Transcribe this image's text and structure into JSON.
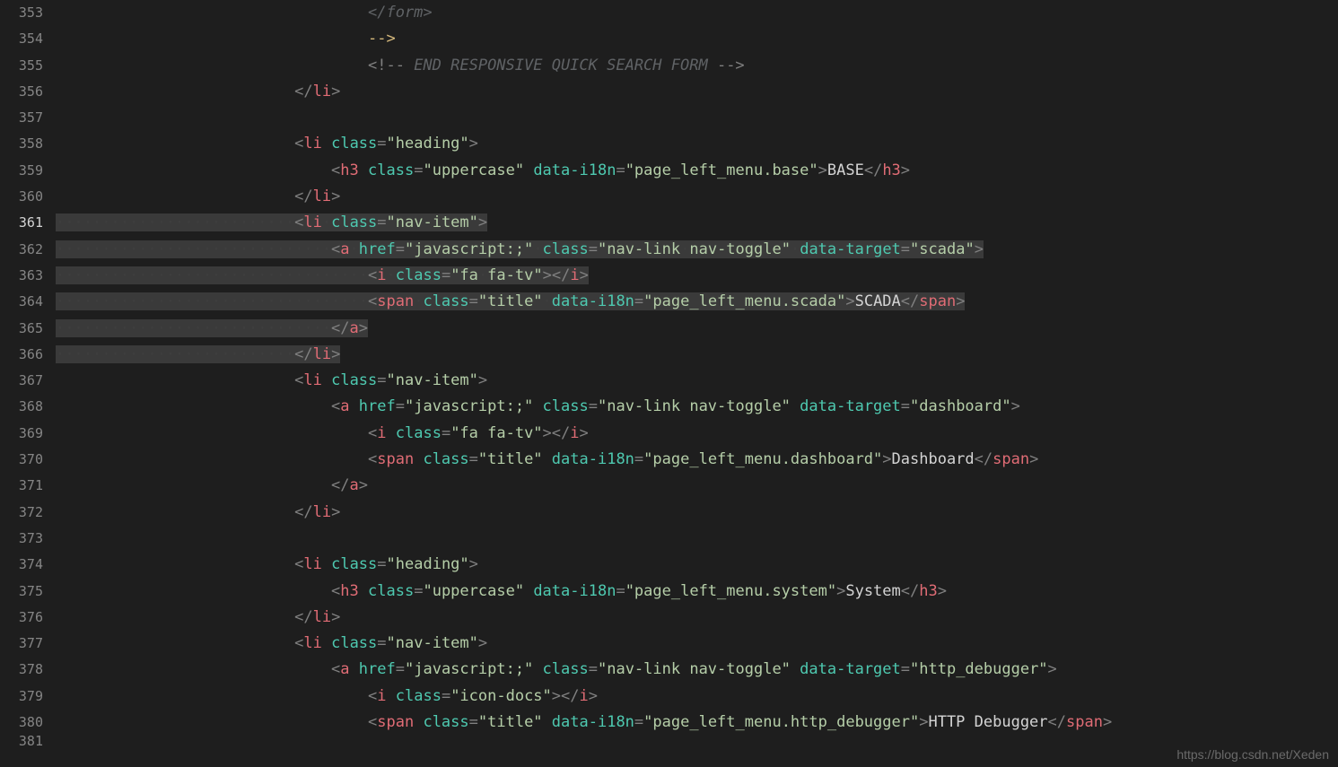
{
  "watermark": "https://blog.csdn.net/Xeden",
  "gutter": {
    "start": 353,
    "end": 381,
    "current": 361
  },
  "whitespace_dot": "·",
  "lines": [
    {
      "n": 353,
      "indent": 40,
      "hl": false,
      "tokens": [
        {
          "c": "cmt",
          "t": "</form>"
        }
      ]
    },
    {
      "n": 354,
      "indent": 40,
      "hl": false,
      "tokens": [
        {
          "c": "yellow",
          "t": "-->"
        }
      ]
    },
    {
      "n": 355,
      "indent": 40,
      "hl": false,
      "tokens": [
        {
          "c": "cmtmark",
          "t": "<!--"
        },
        {
          "c": "cmt",
          "t": " END RESPONSIVE QUICK SEARCH FORM "
        },
        {
          "c": "cmtmark",
          "t": "-->"
        }
      ]
    },
    {
      "n": 356,
      "indent": 32,
      "hl": false,
      "tokens": [
        {
          "c": "br",
          "t": "</"
        },
        {
          "c": "tag",
          "t": "li"
        },
        {
          "c": "br",
          "t": ">"
        }
      ]
    },
    {
      "n": 357,
      "indent": 0,
      "hl": false,
      "tokens": []
    },
    {
      "n": 358,
      "indent": 32,
      "hl": false,
      "tokens": [
        {
          "c": "br",
          "t": "<"
        },
        {
          "c": "tag",
          "t": "li"
        },
        {
          "c": "txt",
          "t": " "
        },
        {
          "c": "attr",
          "t": "class"
        },
        {
          "c": "br",
          "t": "="
        },
        {
          "c": "str",
          "t": "\"heading\""
        },
        {
          "c": "br",
          "t": ">"
        }
      ]
    },
    {
      "n": 359,
      "indent": 36,
      "hl": false,
      "tokens": [
        {
          "c": "br",
          "t": "<"
        },
        {
          "c": "tag",
          "t": "h3"
        },
        {
          "c": "txt",
          "t": " "
        },
        {
          "c": "attr",
          "t": "class"
        },
        {
          "c": "br",
          "t": "="
        },
        {
          "c": "str",
          "t": "\"uppercase\""
        },
        {
          "c": "txt",
          "t": " "
        },
        {
          "c": "attr",
          "t": "data-i18n"
        },
        {
          "c": "br",
          "t": "="
        },
        {
          "c": "str",
          "t": "\"page_left_menu.base\""
        },
        {
          "c": "br",
          "t": ">"
        },
        {
          "c": "txt",
          "t": "BASE"
        },
        {
          "c": "br",
          "t": "</"
        },
        {
          "c": "tag",
          "t": "h3"
        },
        {
          "c": "br",
          "t": ">"
        }
      ]
    },
    {
      "n": 360,
      "indent": 32,
      "hl": false,
      "tokens": [
        {
          "c": "br",
          "t": "</"
        },
        {
          "c": "tag",
          "t": "li"
        },
        {
          "c": "br",
          "t": ">"
        }
      ]
    },
    {
      "n": 361,
      "indent": 32,
      "hl": true,
      "tokens": [
        {
          "c": "br",
          "t": "<"
        },
        {
          "c": "tag",
          "t": "li"
        },
        {
          "c": "ws",
          "t": "·"
        },
        {
          "c": "attr",
          "t": "class"
        },
        {
          "c": "br",
          "t": "="
        },
        {
          "c": "str",
          "t": "\"nav-item\""
        },
        {
          "c": "br",
          "t": ">"
        }
      ]
    },
    {
      "n": 362,
      "indent": 36,
      "hl": true,
      "tokens": [
        {
          "c": "br",
          "t": "<"
        },
        {
          "c": "tag",
          "t": "a"
        },
        {
          "c": "ws",
          "t": "·"
        },
        {
          "c": "attr",
          "t": "href"
        },
        {
          "c": "br",
          "t": "="
        },
        {
          "c": "str",
          "t": "\"javascript:;\""
        },
        {
          "c": "ws",
          "t": "·"
        },
        {
          "c": "attr",
          "t": "class"
        },
        {
          "c": "br",
          "t": "="
        },
        {
          "c": "str",
          "t": "\"nav-link"
        },
        {
          "c": "ws",
          "t": "·"
        },
        {
          "c": "str",
          "t": "nav-toggle\""
        },
        {
          "c": "ws",
          "t": "·"
        },
        {
          "c": "attr",
          "t": "data-target"
        },
        {
          "c": "br",
          "t": "="
        },
        {
          "c": "str",
          "t": "\"scada\""
        },
        {
          "c": "br",
          "t": ">"
        }
      ]
    },
    {
      "n": 363,
      "indent": 40,
      "hl": true,
      "tokens": [
        {
          "c": "br",
          "t": "<"
        },
        {
          "c": "tag",
          "t": "i"
        },
        {
          "c": "ws",
          "t": "·"
        },
        {
          "c": "attr",
          "t": "class"
        },
        {
          "c": "br",
          "t": "="
        },
        {
          "c": "str",
          "t": "\"fa"
        },
        {
          "c": "ws",
          "t": "·"
        },
        {
          "c": "str",
          "t": "fa-tv\""
        },
        {
          "c": "br",
          "t": ">"
        },
        {
          "c": "br",
          "t": "</"
        },
        {
          "c": "tag",
          "t": "i"
        },
        {
          "c": "br",
          "t": ">"
        }
      ]
    },
    {
      "n": 364,
      "indent": 40,
      "hl": true,
      "tokens": [
        {
          "c": "br",
          "t": "<"
        },
        {
          "c": "tag",
          "t": "span"
        },
        {
          "c": "ws",
          "t": "·"
        },
        {
          "c": "attr",
          "t": "class"
        },
        {
          "c": "br",
          "t": "="
        },
        {
          "c": "str",
          "t": "\"title\""
        },
        {
          "c": "ws",
          "t": "·"
        },
        {
          "c": "attr",
          "t": "data-i18n"
        },
        {
          "c": "br",
          "t": "="
        },
        {
          "c": "str",
          "t": "\"page_left_menu.scada\""
        },
        {
          "c": "br",
          "t": ">"
        },
        {
          "c": "txt",
          "t": "SCADA"
        },
        {
          "c": "br",
          "t": "</"
        },
        {
          "c": "tag",
          "t": "span"
        },
        {
          "c": "br",
          "t": ">"
        }
      ]
    },
    {
      "n": 365,
      "indent": 36,
      "hl": true,
      "tokens": [
        {
          "c": "br",
          "t": "</"
        },
        {
          "c": "tag",
          "t": "a"
        },
        {
          "c": "br",
          "t": ">"
        }
      ]
    },
    {
      "n": 366,
      "indent": 32,
      "hl": true,
      "tokens": [
        {
          "c": "br",
          "t": "</"
        },
        {
          "c": "tag",
          "t": "li"
        },
        {
          "c": "br",
          "t": ">"
        }
      ]
    },
    {
      "n": 367,
      "indent": 32,
      "hl": false,
      "tokens": [
        {
          "c": "br",
          "t": "<"
        },
        {
          "c": "tag",
          "t": "li"
        },
        {
          "c": "txt",
          "t": " "
        },
        {
          "c": "attr",
          "t": "class"
        },
        {
          "c": "br",
          "t": "="
        },
        {
          "c": "str",
          "t": "\"nav-item\""
        },
        {
          "c": "br",
          "t": ">"
        }
      ]
    },
    {
      "n": 368,
      "indent": 36,
      "hl": false,
      "tokens": [
        {
          "c": "br",
          "t": "<"
        },
        {
          "c": "tag",
          "t": "a"
        },
        {
          "c": "txt",
          "t": " "
        },
        {
          "c": "attr",
          "t": "href"
        },
        {
          "c": "br",
          "t": "="
        },
        {
          "c": "str",
          "t": "\"javascript:;\""
        },
        {
          "c": "txt",
          "t": " "
        },
        {
          "c": "attr",
          "t": "class"
        },
        {
          "c": "br",
          "t": "="
        },
        {
          "c": "str",
          "t": "\"nav-link nav-toggle\""
        },
        {
          "c": "txt",
          "t": " "
        },
        {
          "c": "attr",
          "t": "data-target"
        },
        {
          "c": "br",
          "t": "="
        },
        {
          "c": "str",
          "t": "\"dashboard\""
        },
        {
          "c": "br",
          "t": ">"
        }
      ]
    },
    {
      "n": 369,
      "indent": 40,
      "hl": false,
      "tokens": [
        {
          "c": "br",
          "t": "<"
        },
        {
          "c": "tag",
          "t": "i"
        },
        {
          "c": "txt",
          "t": " "
        },
        {
          "c": "attr",
          "t": "class"
        },
        {
          "c": "br",
          "t": "="
        },
        {
          "c": "str",
          "t": "\"fa fa-tv\""
        },
        {
          "c": "br",
          "t": ">"
        },
        {
          "c": "br",
          "t": "</"
        },
        {
          "c": "tag",
          "t": "i"
        },
        {
          "c": "br",
          "t": ">"
        }
      ]
    },
    {
      "n": 370,
      "indent": 40,
      "hl": false,
      "tokens": [
        {
          "c": "br",
          "t": "<"
        },
        {
          "c": "tag",
          "t": "span"
        },
        {
          "c": "txt",
          "t": " "
        },
        {
          "c": "attr",
          "t": "class"
        },
        {
          "c": "br",
          "t": "="
        },
        {
          "c": "str",
          "t": "\"title\""
        },
        {
          "c": "txt",
          "t": " "
        },
        {
          "c": "attr",
          "t": "data-i18n"
        },
        {
          "c": "br",
          "t": "="
        },
        {
          "c": "str",
          "t": "\"page_left_menu.dashboard\""
        },
        {
          "c": "br",
          "t": ">"
        },
        {
          "c": "txt",
          "t": "Dashboard"
        },
        {
          "c": "br",
          "t": "</"
        },
        {
          "c": "tag",
          "t": "span"
        },
        {
          "c": "br",
          "t": ">"
        }
      ]
    },
    {
      "n": 371,
      "indent": 36,
      "hl": false,
      "tokens": [
        {
          "c": "br",
          "t": "</"
        },
        {
          "c": "tag",
          "t": "a"
        },
        {
          "c": "br",
          "t": ">"
        }
      ]
    },
    {
      "n": 372,
      "indent": 32,
      "hl": false,
      "tokens": [
        {
          "c": "br",
          "t": "</"
        },
        {
          "c": "tag",
          "t": "li"
        },
        {
          "c": "br",
          "t": ">"
        }
      ]
    },
    {
      "n": 373,
      "indent": 0,
      "hl": false,
      "tokens": []
    },
    {
      "n": 374,
      "indent": 32,
      "hl": false,
      "tokens": [
        {
          "c": "br",
          "t": "<"
        },
        {
          "c": "tag",
          "t": "li"
        },
        {
          "c": "txt",
          "t": " "
        },
        {
          "c": "attr",
          "t": "class"
        },
        {
          "c": "br",
          "t": "="
        },
        {
          "c": "str",
          "t": "\"heading\""
        },
        {
          "c": "br",
          "t": ">"
        }
      ]
    },
    {
      "n": 375,
      "indent": 36,
      "hl": false,
      "tokens": [
        {
          "c": "br",
          "t": "<"
        },
        {
          "c": "tag",
          "t": "h3"
        },
        {
          "c": "txt",
          "t": " "
        },
        {
          "c": "attr",
          "t": "class"
        },
        {
          "c": "br",
          "t": "="
        },
        {
          "c": "str",
          "t": "\"uppercase\""
        },
        {
          "c": "txt",
          "t": " "
        },
        {
          "c": "attr",
          "t": "data-i18n"
        },
        {
          "c": "br",
          "t": "="
        },
        {
          "c": "str",
          "t": "\"page_left_menu.system\""
        },
        {
          "c": "br",
          "t": ">"
        },
        {
          "c": "txt",
          "t": "System"
        },
        {
          "c": "br",
          "t": "</"
        },
        {
          "c": "tag",
          "t": "h3"
        },
        {
          "c": "br",
          "t": ">"
        }
      ]
    },
    {
      "n": 376,
      "indent": 32,
      "hl": false,
      "tokens": [
        {
          "c": "br",
          "t": "</"
        },
        {
          "c": "tag",
          "t": "li"
        },
        {
          "c": "br",
          "t": ">"
        }
      ]
    },
    {
      "n": 377,
      "indent": 32,
      "hl": false,
      "tokens": [
        {
          "c": "br",
          "t": "<"
        },
        {
          "c": "tag",
          "t": "li"
        },
        {
          "c": "txt",
          "t": " "
        },
        {
          "c": "attr",
          "t": "class"
        },
        {
          "c": "br",
          "t": "="
        },
        {
          "c": "str",
          "t": "\"nav-item\""
        },
        {
          "c": "br",
          "t": ">"
        }
      ]
    },
    {
      "n": 378,
      "indent": 36,
      "hl": false,
      "tokens": [
        {
          "c": "br",
          "t": "<"
        },
        {
          "c": "tag",
          "t": "a"
        },
        {
          "c": "txt",
          "t": " "
        },
        {
          "c": "attr",
          "t": "href"
        },
        {
          "c": "br",
          "t": "="
        },
        {
          "c": "str",
          "t": "\"javascript:;\""
        },
        {
          "c": "txt",
          "t": " "
        },
        {
          "c": "attr",
          "t": "class"
        },
        {
          "c": "br",
          "t": "="
        },
        {
          "c": "str",
          "t": "\"nav-link nav-toggle\""
        },
        {
          "c": "txt",
          "t": " "
        },
        {
          "c": "attr",
          "t": "data-target"
        },
        {
          "c": "br",
          "t": "="
        },
        {
          "c": "str",
          "t": "\"http_debugger\""
        },
        {
          "c": "br",
          "t": ">"
        }
      ]
    },
    {
      "n": 379,
      "indent": 40,
      "hl": false,
      "tokens": [
        {
          "c": "br",
          "t": "<"
        },
        {
          "c": "tag",
          "t": "i"
        },
        {
          "c": "txt",
          "t": " "
        },
        {
          "c": "attr",
          "t": "class"
        },
        {
          "c": "br",
          "t": "="
        },
        {
          "c": "str",
          "t": "\"icon-docs\""
        },
        {
          "c": "br",
          "t": ">"
        },
        {
          "c": "br",
          "t": "</"
        },
        {
          "c": "tag",
          "t": "i"
        },
        {
          "c": "br",
          "t": ">"
        }
      ]
    },
    {
      "n": 380,
      "indent": 40,
      "hl": false,
      "tokens": [
        {
          "c": "br",
          "t": "<"
        },
        {
          "c": "tag",
          "t": "span"
        },
        {
          "c": "txt",
          "t": " "
        },
        {
          "c": "attr",
          "t": "class"
        },
        {
          "c": "br",
          "t": "="
        },
        {
          "c": "str",
          "t": "\"title\""
        },
        {
          "c": "txt",
          "t": " "
        },
        {
          "c": "attr",
          "t": "data-i18n"
        },
        {
          "c": "br",
          "t": "="
        },
        {
          "c": "str",
          "t": "\"page_left_menu.http_debugger\""
        },
        {
          "c": "br",
          "t": ">"
        },
        {
          "c": "txt",
          "t": "HTTP Debugger"
        },
        {
          "c": "br",
          "t": "</"
        },
        {
          "c": "tag",
          "t": "span"
        },
        {
          "c": "br",
          "t": ">"
        }
      ]
    },
    {
      "n": 381,
      "indent": 0,
      "hl": false,
      "tokens": [],
      "cut": true
    }
  ]
}
